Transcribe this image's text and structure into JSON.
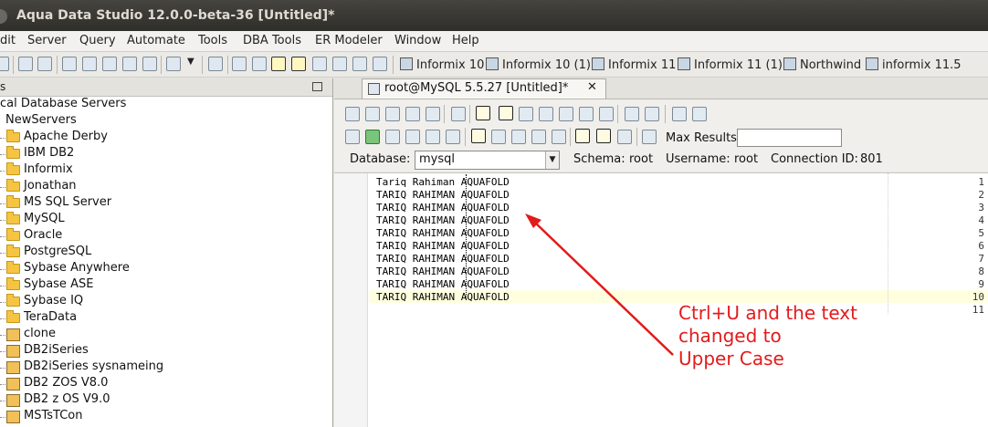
{
  "window": {
    "title": "Aqua Data Studio 12.0.0-beta-36 [Untitled]*"
  },
  "menu": [
    "dit",
    "Server",
    "Query",
    "Automate",
    "Tools",
    "DBA Tools",
    "ER Modeler",
    "Window",
    "Help"
  ],
  "toolbar": {
    "connections": [
      "Informix 10",
      "Informix 10 (1)",
      "Informix 11",
      "Informix 11 (1)",
      "Northwind",
      "informix 11.5"
    ]
  },
  "left_panel": {
    "header": "s",
    "items": [
      {
        "label": "cal Database Servers",
        "kind": "root"
      },
      {
        "label": "NewServers",
        "kind": "group"
      },
      {
        "label": "Apache Derby",
        "kind": "folder"
      },
      {
        "label": "IBM DB2",
        "kind": "folder"
      },
      {
        "label": "Informix",
        "kind": "folder"
      },
      {
        "label": "Jonathan",
        "kind": "folder"
      },
      {
        "label": "MS SQL Server",
        "kind": "folder"
      },
      {
        "label": "MySQL",
        "kind": "folder"
      },
      {
        "label": "Oracle",
        "kind": "folder"
      },
      {
        "label": "PostgreSQL",
        "kind": "folder"
      },
      {
        "label": "Sybase Anywhere",
        "kind": "folder"
      },
      {
        "label": "Sybase ASE",
        "kind": "folder"
      },
      {
        "label": "Sybase IQ",
        "kind": "folder"
      },
      {
        "label": "TeraData",
        "kind": "folder"
      },
      {
        "label": "clone",
        "kind": "server"
      },
      {
        "label": "DB2iSeries",
        "kind": "server"
      },
      {
        "label": "DB2iSeries sysnameing",
        "kind": "server"
      },
      {
        "label": "DB2 ZOS V8.0",
        "kind": "server"
      },
      {
        "label": "DB2 z OS V9.0",
        "kind": "server"
      },
      {
        "label": "MSTsTCon",
        "kind": "server"
      }
    ]
  },
  "editor_tab": {
    "label": "root@MySQL 5.5.27 [Untitled]*",
    "close": "✕"
  },
  "query": {
    "max_results_label": "Max Results:",
    "max_results_value": "",
    "database_label": "Database:",
    "database_value": "mysql",
    "schema_label": "Schema:",
    "schema_value": "root",
    "username_label": "Username:",
    "username_value": "root",
    "connection_label": "Connection ID:",
    "connection_value": "801"
  },
  "editor": {
    "lines": [
      {
        "n": "1",
        "text": "Tariq Rahiman AQUAFOLD"
      },
      {
        "n": "2",
        "text": "TARIQ RAHIMAN AQUAFOLD"
      },
      {
        "n": "3",
        "text": "TARIQ RAHIMAN AQUAFOLD"
      },
      {
        "n": "4",
        "text": "TARIQ RAHIMAN AQUAFOLD"
      },
      {
        "n": "5",
        "text": "TARIQ RAHIMAN AQUAFOLD"
      },
      {
        "n": "6",
        "text": "TARIQ RAHIMAN AQUAFOLD"
      },
      {
        "n": "7",
        "text": "TARIQ RAHIMAN AQUAFOLD"
      },
      {
        "n": "8",
        "text": "TARIQ RAHIMAN AQUAFOLD"
      },
      {
        "n": "9",
        "text": "TARIQ RAHIMAN AQUAFOLD"
      },
      {
        "n": "10",
        "text": "TARIQ RAHIMAN AQUAFOLD"
      },
      {
        "n": "11",
        "text": ""
      }
    ]
  },
  "annotation": {
    "line1": "Ctrl+U and the text",
    "line2": "changed to",
    "line3": "Upper Case",
    "color": "#e21b1b"
  }
}
